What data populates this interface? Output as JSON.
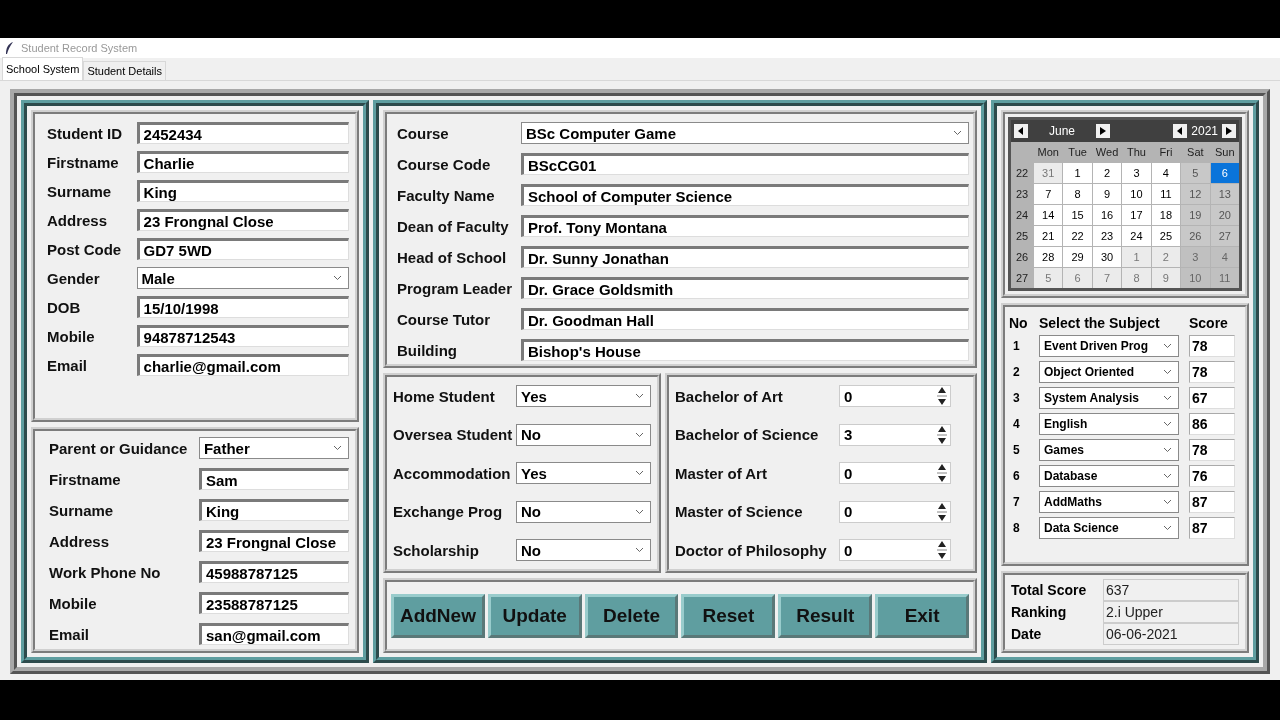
{
  "window": {
    "title": "Student Record System"
  },
  "tabs": [
    {
      "label": "School System",
      "selected": true
    },
    {
      "label": "Student Details",
      "selected": false
    }
  ],
  "student": [
    {
      "label": "Student ID",
      "value": "2452434",
      "kind": "entry"
    },
    {
      "label": "Firstname",
      "value": "Charlie",
      "kind": "entry"
    },
    {
      "label": "Surname",
      "value": "King",
      "kind": "entry"
    },
    {
      "label": "Address",
      "value": "23 Frongnal Close",
      "kind": "entry"
    },
    {
      "label": "Post Code",
      "value": "GD7 5WD",
      "kind": "entry"
    },
    {
      "label": "Gender",
      "value": "Male",
      "kind": "combo"
    },
    {
      "label": "DOB",
      "value": "15/10/1998",
      "kind": "entry"
    },
    {
      "label": "Mobile",
      "value": "94878712543",
      "kind": "entry"
    },
    {
      "label": "Email",
      "value": "charlie@gmail.com",
      "kind": "entry"
    }
  ],
  "guardian": [
    {
      "label": "Parent or Guidance",
      "value": "Father",
      "kind": "combo"
    },
    {
      "label": "Firstname",
      "value": "Sam",
      "kind": "entry"
    },
    {
      "label": "Surname",
      "value": "King",
      "kind": "entry"
    },
    {
      "label": "Address",
      "value": "23 Frongnal Close",
      "kind": "entry"
    },
    {
      "label": "Work Phone No",
      "value": "45988787125",
      "kind": "entry"
    },
    {
      "label": "Mobile",
      "value": "23588787125",
      "kind": "entry"
    },
    {
      "label": "Email",
      "value": "san@gmail.com",
      "kind": "entry"
    }
  ],
  "course": [
    {
      "label": "Course",
      "value": "BSc Computer Game",
      "kind": "combo"
    },
    {
      "label": "Course Code",
      "value": "BScCG01",
      "kind": "entry"
    },
    {
      "label": "Faculty Name",
      "value": "School of Computer Science",
      "kind": "entry"
    },
    {
      "label": "Dean of Faculty",
      "value": "Prof. Tony Montana",
      "kind": "entry"
    },
    {
      "label": "Head of School",
      "value": "Dr. Sunny Jonathan",
      "kind": "entry"
    },
    {
      "label": "Program Leader",
      "value": "Dr. Grace Goldsmith",
      "kind": "entry"
    },
    {
      "label": "Course Tutor",
      "value": "Dr. Goodman Hall",
      "kind": "entry"
    },
    {
      "label": "Building",
      "value": "Bishop's House",
      "kind": "entry"
    }
  ],
  "status": [
    {
      "label": "Home Student",
      "value": "Yes",
      "kind": "combo"
    },
    {
      "label": "Oversea Student",
      "value": "No",
      "kind": "combo"
    },
    {
      "label": "Accommodation",
      "value": "Yes",
      "kind": "combo"
    },
    {
      "label": "Exchange Prog",
      "value": "No",
      "kind": "combo"
    },
    {
      "label": "Scholarship",
      "value": "No",
      "kind": "combo"
    }
  ],
  "degrees": [
    {
      "label": "Bachelor of Art",
      "value": "0",
      "kind": "spin"
    },
    {
      "label": "Bachelor of Science",
      "value": "3",
      "kind": "spin"
    },
    {
      "label": "Master of Art",
      "value": "0",
      "kind": "spin"
    },
    {
      "label": "Master of Science",
      "value": "0",
      "kind": "spin"
    },
    {
      "label": "Doctor of Philosophy",
      "value": "0",
      "kind": "spin"
    }
  ],
  "buttons": [
    "AddNew",
    "Update",
    "Delete",
    "Reset",
    "Result",
    "Exit"
  ],
  "calendar": {
    "month": "June",
    "year": "2021",
    "weekdays": [
      "Mon",
      "Tue",
      "Wed",
      "Thu",
      "Fri",
      "Sat",
      "Sun"
    ],
    "weeks": [
      {
        "number": "22",
        "days": [
          {
            "label": "31",
            "kind": "outside",
            "selected": false
          },
          {
            "label": "1",
            "kind": "weekday",
            "selected": false
          },
          {
            "label": "2",
            "kind": "weekday",
            "selected": false
          },
          {
            "label": "3",
            "kind": "weekday",
            "selected": false
          },
          {
            "label": "4",
            "kind": "weekday",
            "selected": false
          },
          {
            "label": "5",
            "kind": "weekend",
            "selected": false
          },
          {
            "label": "6",
            "kind": "weekend",
            "selected": true
          }
        ]
      },
      {
        "number": "23",
        "days": [
          {
            "label": "7",
            "kind": "weekday",
            "selected": false
          },
          {
            "label": "8",
            "kind": "weekday",
            "selected": false
          },
          {
            "label": "9",
            "kind": "weekday",
            "selected": false
          },
          {
            "label": "10",
            "kind": "weekday",
            "selected": false
          },
          {
            "label": "11",
            "kind": "weekday",
            "selected": false
          },
          {
            "label": "12",
            "kind": "weekend",
            "selected": false
          },
          {
            "label": "13",
            "kind": "weekend",
            "selected": false
          }
        ]
      },
      {
        "number": "24",
        "days": [
          {
            "label": "14",
            "kind": "weekday",
            "selected": false
          },
          {
            "label": "15",
            "kind": "weekday",
            "selected": false
          },
          {
            "label": "16",
            "kind": "weekday",
            "selected": false
          },
          {
            "label": "17",
            "kind": "weekday",
            "selected": false
          },
          {
            "label": "18",
            "kind": "weekday",
            "selected": false
          },
          {
            "label": "19",
            "kind": "weekend",
            "selected": false
          },
          {
            "label": "20",
            "kind": "weekend",
            "selected": false
          }
        ]
      },
      {
        "number": "25",
        "days": [
          {
            "label": "21",
            "kind": "weekday",
            "selected": false
          },
          {
            "label": "22",
            "kind": "weekday",
            "selected": false
          },
          {
            "label": "23",
            "kind": "weekday",
            "selected": false
          },
          {
            "label": "24",
            "kind": "weekday",
            "selected": false
          },
          {
            "label": "25",
            "kind": "weekday",
            "selected": false
          },
          {
            "label": "26",
            "kind": "weekend",
            "selected": false
          },
          {
            "label": "27",
            "kind": "weekend",
            "selected": false
          }
        ]
      },
      {
        "number": "26",
        "days": [
          {
            "label": "28",
            "kind": "weekday",
            "selected": false
          },
          {
            "label": "29",
            "kind": "weekday",
            "selected": false
          },
          {
            "label": "30",
            "kind": "weekday",
            "selected": false
          },
          {
            "label": "1",
            "kind": "outside",
            "selected": false
          },
          {
            "label": "2",
            "kind": "outside",
            "selected": false
          },
          {
            "label": "3",
            "kind": "outside_weekend",
            "selected": false
          },
          {
            "label": "4",
            "kind": "outside_weekend",
            "selected": false
          }
        ]
      },
      {
        "number": "27",
        "days": [
          {
            "label": "5",
            "kind": "outside",
            "selected": false
          },
          {
            "label": "6",
            "kind": "outside",
            "selected": false
          },
          {
            "label": "7",
            "kind": "outside",
            "selected": false
          },
          {
            "label": "8",
            "kind": "outside",
            "selected": false
          },
          {
            "label": "9",
            "kind": "outside",
            "selected": false
          },
          {
            "label": "10",
            "kind": "outside_weekend",
            "selected": false
          },
          {
            "label": "11",
            "kind": "outside_weekend",
            "selected": false
          }
        ]
      }
    ]
  },
  "subjects": {
    "headers": [
      "No",
      "Select the Subject",
      "Score"
    ],
    "rows": [
      {
        "no": "1",
        "subject": "Event Driven Prog",
        "score": "78"
      },
      {
        "no": "2",
        "subject": "Object Oriented",
        "score": "78"
      },
      {
        "no": "3",
        "subject": "System Analysis",
        "score": "67"
      },
      {
        "no": "4",
        "subject": "English",
        "score": "86"
      },
      {
        "no": "5",
        "subject": "Games",
        "score": "78"
      },
      {
        "no": "6",
        "subject": "Database",
        "score": "76"
      },
      {
        "no": "7",
        "subject": "AddMaths",
        "score": "87"
      },
      {
        "no": "8",
        "subject": "Data Science",
        "score": "87"
      }
    ]
  },
  "totals": [
    {
      "label": "Total Score",
      "value": "637"
    },
    {
      "label": "Ranking",
      "value": "2.i Upper"
    },
    {
      "label": "Date",
      "value": "06-06-2021"
    }
  ]
}
